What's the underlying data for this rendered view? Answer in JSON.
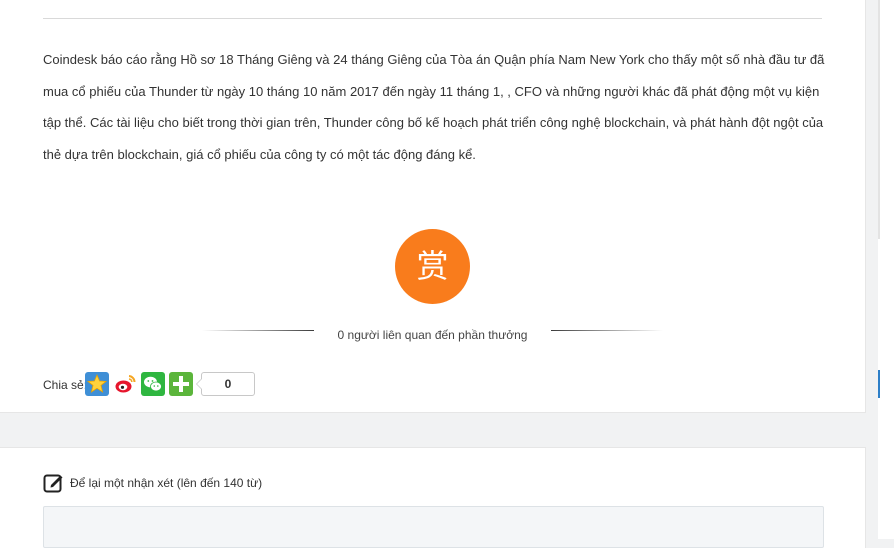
{
  "article": {
    "body": "Coindesk báo cáo rằng Hồ sơ 18 Tháng Giêng và 24 tháng Giêng của Tòa án Quận phía Nam New York cho thấy một số nhà đầu tư đã mua cổ phiếu của Thunder từ ngày 10 tháng 10 năm 2017 đến ngày 11 tháng 1, , CFO và những người khác đã phát động một vụ kiện tập thể. Các tài liệu cho biết trong thời gian trên, Thunder công bố kế hoạch phát triển công nghệ blockchain, và phát hành đột ngột của thẻ dựa trên blockchain, giá cổ phiếu của công ty có một tác động đáng kể."
  },
  "reward": {
    "button_glyph": "赏",
    "count_text": "0 người liên quan đến phần thưởng",
    "button_color": "#f97c1c"
  },
  "share": {
    "label": "Chia sẻ:",
    "icons": [
      "qzone-star-icon",
      "weibo-icon",
      "wechat-icon",
      "more-plus-icon"
    ],
    "count": "0"
  },
  "comment": {
    "heading": "Để lại một nhận xét (lên đến 140 từ)",
    "input_value": ""
  }
}
